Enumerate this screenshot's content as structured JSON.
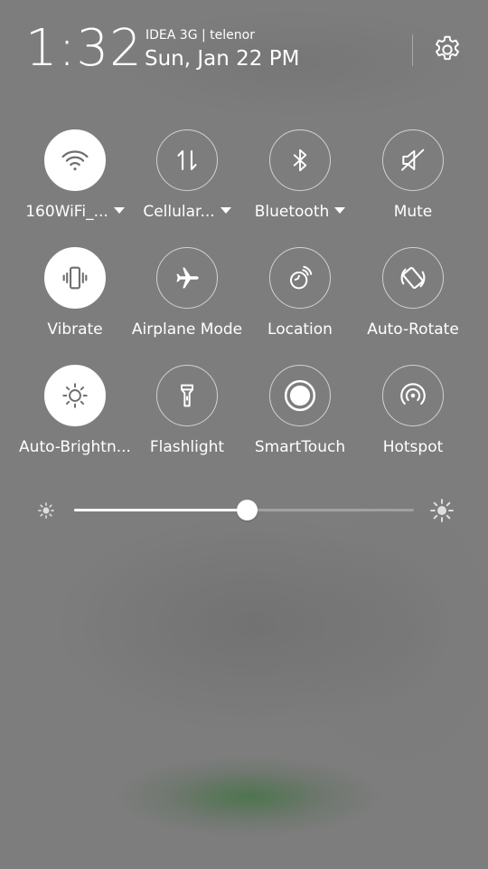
{
  "header": {
    "time": "1:32",
    "carrier": "IDEA 3G | telenor",
    "date": "Sun, Jan 22 PM"
  },
  "tiles": [
    {
      "label": "160WiFi_...",
      "icon": "wifi-icon",
      "on": true,
      "dropdown": true
    },
    {
      "label": "Cellular...",
      "icon": "cellular-data-icon",
      "on": false,
      "dropdown": true
    },
    {
      "label": "Bluetooth",
      "icon": "bluetooth-icon",
      "on": false,
      "dropdown": true
    },
    {
      "label": "Mute",
      "icon": "mute-icon",
      "on": false,
      "dropdown": false
    },
    {
      "label": "Vibrate",
      "icon": "vibrate-icon",
      "on": true,
      "dropdown": false
    },
    {
      "label": "Airplane Mode",
      "icon": "airplane-icon",
      "on": false,
      "dropdown": false
    },
    {
      "label": "Location",
      "icon": "location-icon",
      "on": false,
      "dropdown": false
    },
    {
      "label": "Auto-Rotate",
      "icon": "auto-rotate-icon",
      "on": false,
      "dropdown": false
    },
    {
      "label": "Auto-Brightn...",
      "icon": "auto-brightness-icon",
      "on": true,
      "dropdown": false
    },
    {
      "label": "Flashlight",
      "icon": "flashlight-icon",
      "on": false,
      "dropdown": false
    },
    {
      "label": "SmartTouch",
      "icon": "smarttouch-icon",
      "on": false,
      "dropdown": false
    },
    {
      "label": "Hotspot",
      "icon": "hotspot-icon",
      "on": false,
      "dropdown": false
    }
  ],
  "brightness": {
    "level": 0.51
  },
  "colors": {
    "background": "#7d7d7d",
    "active_tile": "#ffffff",
    "active_icon": "#6f6f6f",
    "blur_accent": "#4a7a4a"
  }
}
